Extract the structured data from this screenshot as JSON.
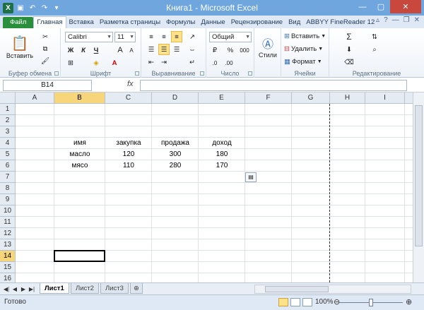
{
  "window": {
    "title": "Книга1 - Microsoft Excel"
  },
  "ribbon_tabs": [
    "Файл",
    "Главная",
    "Вставка",
    "Разметка страницы",
    "Формулы",
    "Данные",
    "Рецензирование",
    "Вид",
    "ABBYY FineReader 12"
  ],
  "ribbon": {
    "clipboard": {
      "paste_label": "Вставить",
      "group_label": "Буфер обмена"
    },
    "font": {
      "font_name": "Calibri",
      "font_size": "11",
      "bold": "Ж",
      "italic": "К",
      "underline": "Ч",
      "grow": "A",
      "shrink": "A",
      "font_color": "A",
      "group_label": "Шрифт"
    },
    "alignment": {
      "group_label": "Выравнивание"
    },
    "number": {
      "format": "Общий",
      "percent": "%",
      "thousands": "000",
      "group_label": "Число"
    },
    "styles": {
      "label": "Стили"
    },
    "cells": {
      "insert": "Вставить",
      "delete": "Удалить",
      "format": "Формат",
      "group_label": "Ячейки"
    },
    "editing": {
      "sum": "Σ",
      "group_label": "Редактирование"
    }
  },
  "formula_bar": {
    "name_box": "B14",
    "fx": "fx",
    "content": ""
  },
  "columns": [
    "A",
    "B",
    "C",
    "D",
    "E",
    "F",
    "G",
    "H",
    "I"
  ],
  "rows": [
    "1",
    "2",
    "3",
    "4",
    "5",
    "6",
    "7",
    "8",
    "9",
    "10",
    "11",
    "12",
    "13",
    "14",
    "15",
    "16"
  ],
  "cells": {
    "B4": "имя",
    "C4": "закупка",
    "D4": "продажа",
    "E4": "доход",
    "B5": "масло",
    "C5": "120",
    "D5": "300",
    "E5": "180",
    "B6": "мясо",
    "C6": "110",
    "D6": "280",
    "E6": "170"
  },
  "sheets": [
    "Лист1",
    "Лист2",
    "Лист3"
  ],
  "active_sheet": "Лист1",
  "status": {
    "text": "Готово",
    "zoom": "100%"
  },
  "colors": {
    "title_bar": "#6fa6dd",
    "file_tab": "#2a8f3d",
    "selected_header": "#f7d57b"
  }
}
